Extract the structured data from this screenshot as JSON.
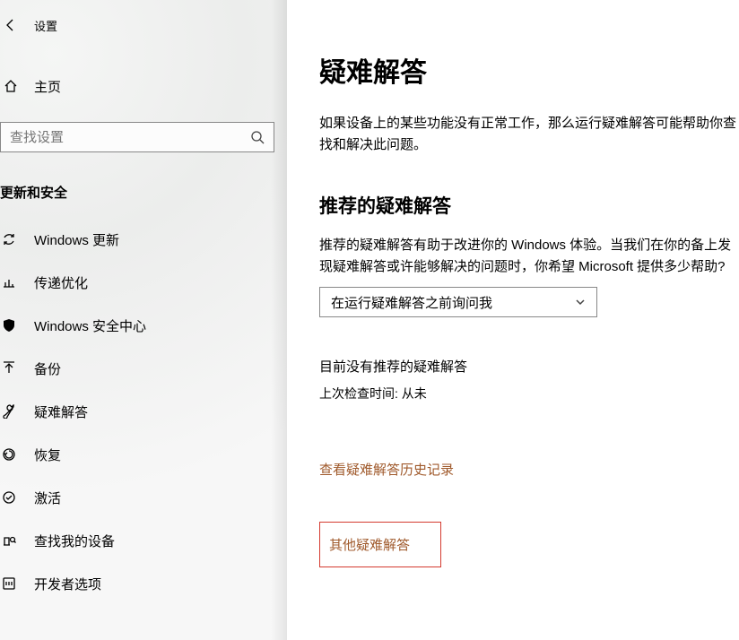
{
  "window": {
    "title": "设置"
  },
  "sidebar": {
    "home": "主页",
    "search_placeholder": "查找设置",
    "category": "更新和安全",
    "items": [
      {
        "label": "Windows 更新"
      },
      {
        "label": "传递优化"
      },
      {
        "label": "Windows 安全中心"
      },
      {
        "label": "备份"
      },
      {
        "label": "疑难解答"
      },
      {
        "label": "恢复"
      },
      {
        "label": "激活"
      },
      {
        "label": "查找我的设备"
      },
      {
        "label": "开发者选项"
      }
    ]
  },
  "main": {
    "title": "疑难解答",
    "intro": "如果设备上的某些功能没有正常工作，那么运行疑难解答可能帮助你查找和解决此问题。",
    "rec_title": "推荐的疑难解答",
    "rec_desc": "推荐的疑难解答有助于改进你的 Windows 体验。当我们在你的备上发现疑难解答或许能够解决的问题时，你希望 Microsoft 提供多少帮助?",
    "dropdown_value": "在运行疑难解答之前询问我",
    "none_text": "目前没有推荐的疑难解答",
    "last_check_text": "上次检查时间: 从未",
    "view_history": "查看疑难解答历史记录",
    "other": "其他疑难解答"
  }
}
